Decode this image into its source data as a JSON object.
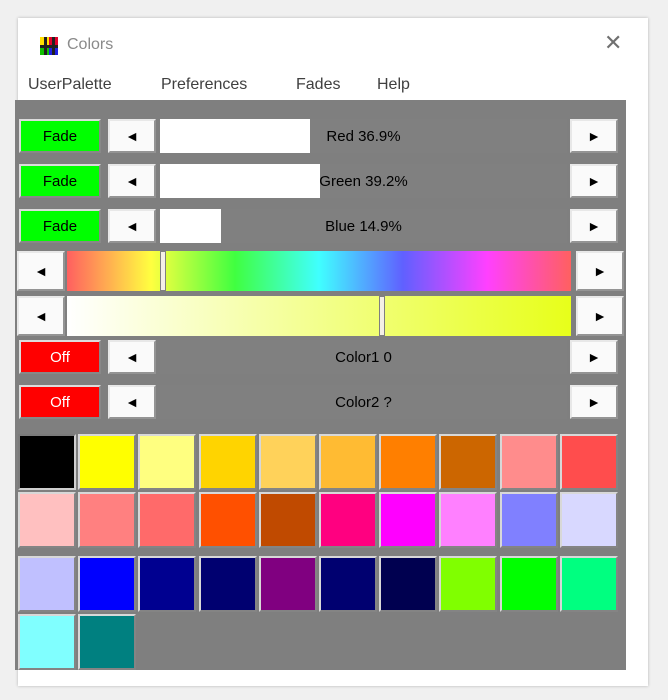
{
  "window": {
    "title": "Colors",
    "close_glyph": "✕"
  },
  "menu": [
    "UserPalette",
    "Preferences",
    "Fades",
    "Help"
  ],
  "channels": [
    {
      "fade_label": "Fade",
      "label": "Red 36.9%",
      "value": 0.369
    },
    {
      "fade_label": "Fade",
      "label": "Green 39.2%",
      "value": 0.392
    },
    {
      "fade_label": "Fade",
      "label": "Blue 14.9%",
      "value": 0.149
    }
  ],
  "hue_slider": {
    "position": 0.19,
    "gradient": [
      "#ff6060",
      "#ffff40",
      "#40ff40",
      "#40ffff",
      "#6060ff",
      "#ff40ff",
      "#ff6060"
    ]
  },
  "brightness_slider": {
    "position": 0.625,
    "gradient": [
      "#ffffff",
      "#e7ff1a"
    ]
  },
  "color_rows": [
    {
      "toggle_label": "Off",
      "label": "Color1 0"
    },
    {
      "toggle_label": "Off",
      "label": "Color2 ?"
    }
  ],
  "arrows": {
    "left": "◄",
    "right": "►"
  },
  "palette": [
    "#000000",
    "#ffff00",
    "#ffff80",
    "#ffd400",
    "#ffd25a",
    "#ffbb33",
    "#ff7f00",
    "#cc6600",
    "#ff8c8c",
    "#ff4d4d",
    "#ffc0c0",
    "#ff8080",
    "#ff6a6a",
    "#ff5000",
    "#c04a00",
    "#ff0080",
    "#ff00ff",
    "#ff80ff",
    "#8080ff",
    "#d8d8ff",
    "#c0c0ff",
    "#0000ff",
    "#000090",
    "#000070",
    "#800080",
    "#000070",
    "#000050",
    "#80ff00",
    "#00ff00",
    "#00ff80",
    "#80ffff",
    "#008080"
  ],
  "selected_swatch": 0
}
